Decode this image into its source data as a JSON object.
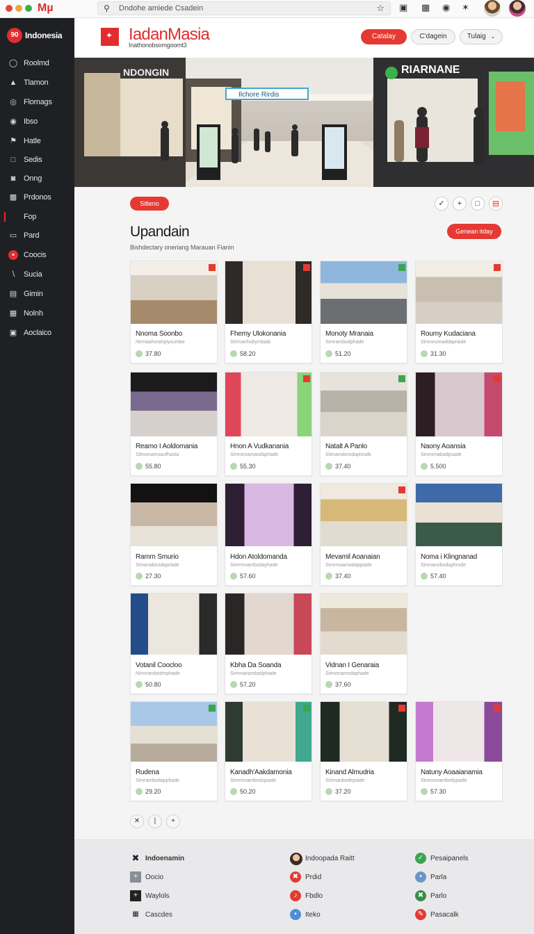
{
  "browser": {
    "brand": "Mµ",
    "search_text": "Dndohe amiede Csadein"
  },
  "sidebar": {
    "brand": "Indonesia",
    "brand_logo": "90",
    "items": [
      {
        "label": "Roolmd",
        "icon": "circle-outline-icon"
      },
      {
        "label": "Tlamon",
        "icon": "hat-icon"
      },
      {
        "label": "Flomags",
        "icon": "target-icon"
      },
      {
        "label": "Ibso",
        "icon": "globe-icon"
      },
      {
        "label": "Hatle",
        "icon": "flag-icon"
      },
      {
        "label": "Sedis",
        "icon": "square-icon"
      },
      {
        "label": "Onng",
        "icon": "disc-icon"
      },
      {
        "label": "Prdonos",
        "icon": "car-icon"
      },
      {
        "label": "Fop",
        "icon": "dash-icon"
      },
      {
        "label": "Pard",
        "icon": "folder-icon"
      },
      {
        "label": "Coocis",
        "icon": "red-circle-icon"
      },
      {
        "label": "Sucia",
        "icon": "pin-icon"
      },
      {
        "label": "Gimin",
        "icon": "box-icon"
      },
      {
        "label": "Nolnh",
        "icon": "grid-icon"
      },
      {
        "label": "Aoclaico",
        "icon": "image-icon"
      }
    ]
  },
  "header": {
    "title": "IadanMasia",
    "subtitle": "Inathonobsomgoomt3",
    "btn_catalog": "Catalay",
    "btn_gagein": "C'dagein",
    "btn_tulaig": "Tulaig"
  },
  "hero": {
    "store_left": "NDONGIN",
    "store_right": "RIARNANE",
    "center_sign": "Ilchore Rirdis"
  },
  "toolbar": {
    "pill_label": "Sitleno"
  },
  "page": {
    "title": "Upandain",
    "subtitle": "Bishdectary oneriang Marauan Fianin",
    "compare_btn": "Genean itday"
  },
  "cards": [
    {
      "name": "Nnoma Soonbo",
      "meta": "Nirmaahorahpiyoumbe",
      "price": "37.80"
    },
    {
      "name": "Fhemy Ulokonania",
      "meta": "Sirimanhobymbaib",
      "price": "58.20"
    },
    {
      "name": "Monoty Mranaia",
      "meta": "Simrambodphade",
      "price": "51.20"
    },
    {
      "name": "Roumy Kudaciana",
      "meta": "Simroromaddapriade",
      "price": "31.30"
    },
    {
      "name": "Reamo I Aoldomania",
      "meta": "Sitmonamoaufhasta",
      "price": "55.80"
    },
    {
      "name": "Hnon A Vudkanania",
      "meta": "Simroroamaodaphade",
      "price": "55.30"
    },
    {
      "name": "Natalt A Panlo",
      "meta": "Sitmanobnodapiroalk",
      "price": "37.40"
    },
    {
      "name": "Naony Aoansia",
      "meta": "Simromabadpsade",
      "price": "5.500"
    },
    {
      "name": "Ramm Smurio",
      "meta": "Simanabnodapriade",
      "price": "27.30"
    },
    {
      "name": "Hdon Atoldomanda",
      "meta": "Simrmnambodayhade",
      "price": "57.60"
    },
    {
      "name": "Mevamil Aoanaian",
      "meta": "Simrmaamodappiade",
      "price": "37.40"
    },
    {
      "name": "Noma i Klingnanad",
      "meta": "Sinmanobodaphrode",
      "price": "57.40"
    },
    {
      "name": "Votanil Coocloo",
      "meta": "Nirmrambodmphade",
      "price": "50.80"
    },
    {
      "name": "Kbha Da Soanda",
      "meta": "Simmanambadphade",
      "price": "57.20"
    },
    {
      "name": "Vidnan I Genaraia",
      "meta": "Sitmonamodaphade",
      "price": "37.60"
    },
    {
      "name": "Rudena",
      "meta": "Simrambodapphade",
      "price": "29.20"
    },
    {
      "name": "Kanadh'Aakdamonia",
      "meta": "Simrmnambodspiade",
      "price": "50.20"
    },
    {
      "name": "Kinand Almudria",
      "meta": "Sirimanbodepiade",
      "price": "37.20"
    },
    {
      "name": "Natuny Aoaaianamia",
      "meta": "Simronoambodypade",
      "price": "57.30"
    }
  ],
  "footer": {
    "col1": [
      {
        "label": "Indoenamin",
        "icon": "logo-icon"
      },
      {
        "label": "Oocio",
        "icon": "plus-icon"
      },
      {
        "label": "Waylols",
        "icon": "plus-dark-icon"
      },
      {
        "label": "Cascdes",
        "icon": "grid-icon"
      }
    ],
    "col2": [
      {
        "label": "Indoopada Raitt",
        "icon": "avatar-icon"
      },
      {
        "label": "Prdid",
        "icon": "red-circle-icon"
      },
      {
        "label": "Fbdlo",
        "icon": "red-circle-icon"
      },
      {
        "label": "Iteko",
        "icon": "blue-circle-icon"
      }
    ],
    "col3": [
      {
        "label": "Pesaipanels",
        "icon": "green-circle-icon"
      },
      {
        "label": "Parla",
        "icon": "blue-circle-icon"
      },
      {
        "label": "Parlo",
        "icon": "green-circle-icon"
      },
      {
        "label": "Pasacalk",
        "icon": "red-circle-icon"
      }
    ]
  },
  "colors": {
    "accent": "#e43a33",
    "sidebar": "#1f2024"
  }
}
